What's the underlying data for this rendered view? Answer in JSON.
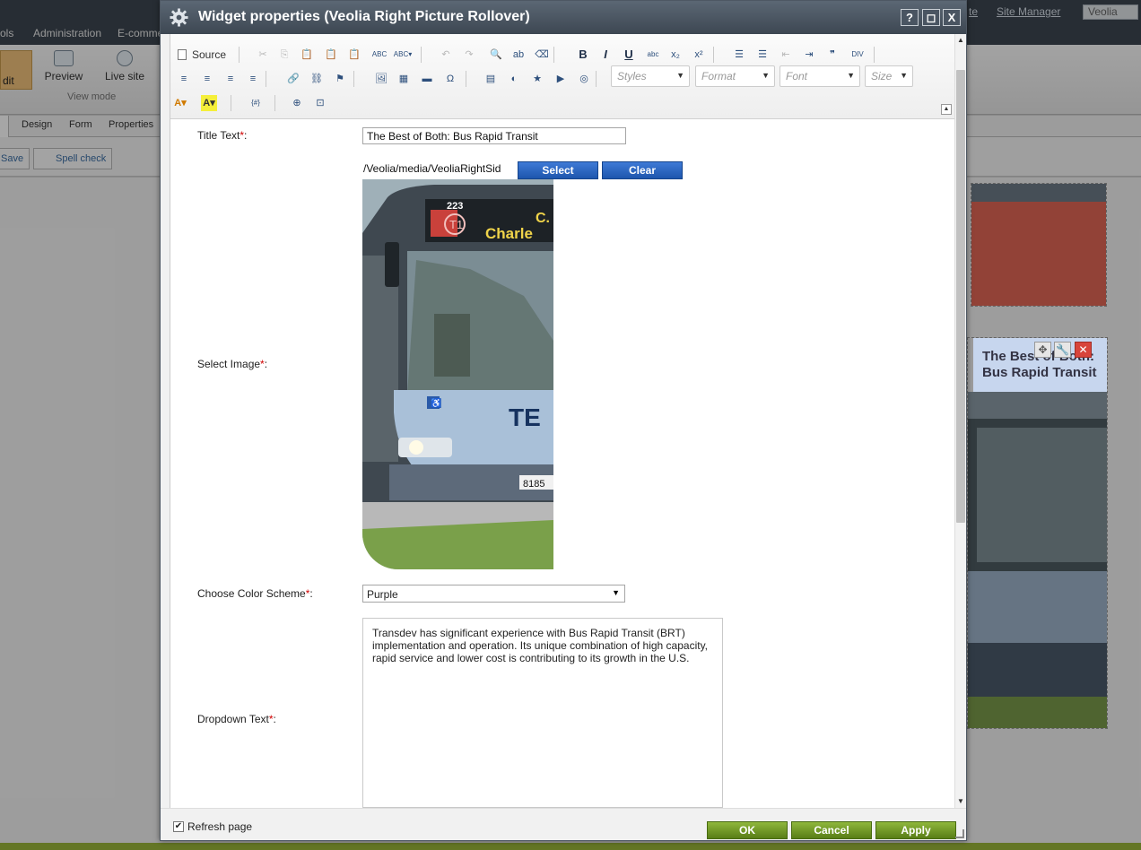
{
  "background": {
    "menu": [
      "ols",
      "Administration",
      "E-comme"
    ],
    "right_links": [
      "te",
      "Site Manager"
    ],
    "site_selector": "Veolia",
    "ribbon": {
      "edit_label": "dit",
      "preview_label": "Preview",
      "live_site_label": "Live site",
      "group_caption": "View mode"
    },
    "tabs": [
      "Design",
      "Form",
      "Properties"
    ],
    "toolbar": {
      "save_label": "Save",
      "spell_check_label": "Spell check"
    },
    "widget_title": "The Best of Both: Bus Rapid Transit"
  },
  "dialog": {
    "title": "Widget properties (Veolia Right Picture Rollover)",
    "title_buttons": {
      "help": "?",
      "maximize": "◻",
      "close": "X"
    },
    "editor": {
      "source_label": "Source",
      "styles_placeholder": "Styles",
      "format_placeholder": "Format",
      "font_placeholder": "Font",
      "size_placeholder": "Size",
      "row1_icons": [
        {
          "name": "cut-icon",
          "glyph": "✂",
          "dim": true
        },
        {
          "name": "copy-icon",
          "glyph": "⎘",
          "dim": true
        },
        {
          "name": "paste-icon",
          "glyph": "📋",
          "dim": false
        },
        {
          "name": "paste-text-icon",
          "glyph": "📋",
          "dim": false
        },
        {
          "name": "paste-word-icon",
          "glyph": "📋",
          "dim": false
        },
        {
          "name": "spellcheck-icon",
          "glyph": "ABC",
          "dim": false
        },
        {
          "name": "spellcheck-as-you-type-icon",
          "glyph": "ABC▾",
          "dim": false
        },
        {
          "name": "undo-icon",
          "glyph": "↶",
          "dim": true
        },
        {
          "name": "redo-icon",
          "glyph": "↷",
          "dim": true
        },
        {
          "name": "find-icon",
          "glyph": "🔍",
          "dim": false
        },
        {
          "name": "replace-icon",
          "glyph": "ab",
          "dim": false
        },
        {
          "name": "remove-format-icon",
          "glyph": "⌫",
          "dim": false
        },
        {
          "name": "bold-icon",
          "glyph": "B",
          "dim": false
        },
        {
          "name": "italic-icon",
          "glyph": "I",
          "dim": false
        },
        {
          "name": "underline-icon",
          "glyph": "U",
          "dim": false
        },
        {
          "name": "strikethrough-icon",
          "glyph": "abc",
          "dim": false
        },
        {
          "name": "subscript-icon",
          "glyph": "x₂",
          "dim": false
        },
        {
          "name": "superscript-icon",
          "glyph": "x²",
          "dim": false
        },
        {
          "name": "numbered-list-icon",
          "glyph": "☰",
          "dim": false
        },
        {
          "name": "bulleted-list-icon",
          "glyph": "☰",
          "dim": false
        },
        {
          "name": "outdent-icon",
          "glyph": "⇤",
          "dim": true
        },
        {
          "name": "indent-icon",
          "glyph": "⇥",
          "dim": false
        },
        {
          "name": "blockquote-icon",
          "glyph": "❞",
          "dim": false
        },
        {
          "name": "div-icon",
          "glyph": "DIV",
          "dim": false
        }
      ],
      "row2_icons": [
        {
          "name": "align-left-icon",
          "glyph": "≡"
        },
        {
          "name": "align-center-icon",
          "glyph": "≡"
        },
        {
          "name": "align-right-icon",
          "glyph": "≡"
        },
        {
          "name": "justify-icon",
          "glyph": "≡"
        },
        {
          "name": "insert-link-icon",
          "glyph": "🔗"
        },
        {
          "name": "unlink-icon",
          "glyph": "⛓"
        },
        {
          "name": "anchor-icon",
          "glyph": "⚑"
        },
        {
          "name": "insert-image-icon",
          "glyph": "🖼"
        },
        {
          "name": "table-icon",
          "glyph": "▦"
        },
        {
          "name": "horizontal-line-icon",
          "glyph": "▬"
        },
        {
          "name": "special-char-icon",
          "glyph": "Ω"
        },
        {
          "name": "inline-widget-icon",
          "glyph": "▤"
        },
        {
          "name": "macro-icon",
          "glyph": "◐"
        },
        {
          "name": "smiley-icon",
          "glyph": "★"
        },
        {
          "name": "youtube-icon",
          "glyph": "▶"
        },
        {
          "name": "media-icon",
          "glyph": "◎"
        }
      ],
      "row3_icons": [
        {
          "name": "text-color-icon",
          "glyph": "A▾"
        },
        {
          "name": "background-color-icon",
          "glyph": "A▾"
        },
        {
          "name": "insert-macro-icon",
          "glyph": "{#}"
        },
        {
          "name": "maximize-icon",
          "glyph": "⊕"
        },
        {
          "name": "show-blocks-icon",
          "glyph": "⊡"
        }
      ]
    },
    "form": {
      "title_text_label": "Title Text",
      "title_text_value": "The Best of Both: Bus Rapid Transit",
      "select_image_label": "Select Image",
      "image_path": "/Veolia/media/VeoliaRightSid",
      "select_button": "Select",
      "clear_button": "Clear",
      "bus_route_number": "223",
      "bus_route_badge": "T1",
      "bus_destination": "Charle",
      "bus_destination_top": "C.",
      "bus_brand": "TE",
      "bus_plate": "8185",
      "color_scheme_label": "Choose Color Scheme",
      "color_scheme_value": "Purple",
      "dropdown_text_label": "Dropdown Text",
      "dropdown_text_value": "Transdev has significant experience with Bus Rapid Transit (BRT) implementation and operation. Its unique combination of high capacity, rapid service and lower cost is contributing to its growth in the U.S.",
      "required_marker": "*",
      "colon": ":"
    },
    "footer": {
      "refresh_label": "Refresh page",
      "refresh_checked": true,
      "ok_button": "OK",
      "cancel_button": "Cancel",
      "apply_button": "Apply"
    }
  },
  "colors": {
    "titlebar": "#4a5562",
    "select_button": "#2563c0",
    "ok_button": "#6d9424",
    "required": "#d00000",
    "highlight_red": "#e06655"
  }
}
